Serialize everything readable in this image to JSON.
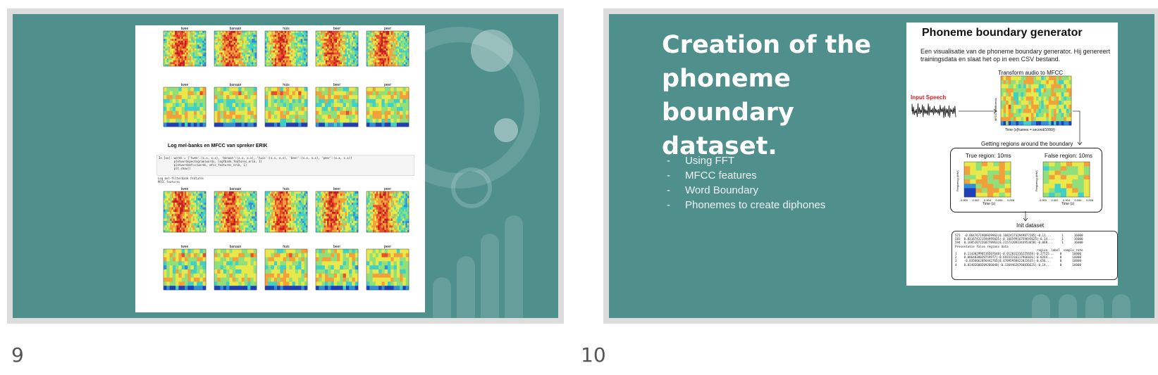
{
  "slides": [
    {
      "number": "9",
      "notebook": {
        "words": [
          "twee",
          "banaan",
          "huis",
          "beer",
          "peer"
        ],
        "section_title": "Log mel-banks en MFCC van spreker ERIK",
        "code_lines": [
          "In [xx]: words = {'twee':(x.x, x.x), 'banaan':(x.x, x.x), 'huis':(x.x, x.x), 'beer':(x.x, x.x), 'peer':(x.x, x.x)}",
          "         plotwordspectogram(words, logfbank_features_erik, 1)",
          "         plotwordsmfcc(words, mfcc_features_erik, 1)",
          "         plt.show()"
        ],
        "output_lines": [
          "Log mel-filterbank features",
          "MFCC features"
        ]
      },
      "colors": {
        "background": "#4f908d"
      }
    },
    {
      "number": "10",
      "title": "Creation of the phoneme boundary dataset.",
      "bullets": [
        "Using FFT",
        "MFCC features",
        "Word Boundary",
        "Phonemes to create diphones"
      ],
      "figure": {
        "title": "Phoneme boundary generator",
        "description": "Een visualisatie van de phoneme boundary generator. Hij genereert trainingsdata en slaat het op in een CSV bestand.",
        "transform_label": "Transform audio to MFCC",
        "input_label": "Input Speech",
        "mfcc_ylabel": "MFCC coefficients",
        "mfcc_xlabel": "Time (x(frames = second/1000))",
        "regions_label": "Getting regions around the boundary",
        "true_region_label": "True region: 10ms",
        "false_region_label": "False region: 10ms",
        "freq_label": "Frequency (kHz)",
        "time_label": "Time (s)",
        "region_ticks": [
          "0.000",
          "0.002",
          "0.004",
          "0.006",
          "0.008"
        ],
        "init_label": "Init dataset",
        "dataset_lines": [
          "573  -0.0647671908929962|0.168241732949877285|-0.11...      1      16000",
          "583  0.031674321594995035|-0.16659916759693625|-0.14...     1      16000",
          "594  0.16852072268778963|0.215732091344953658|-0.068...     1      16000",
          "Presentatie false regions data",
          "                                              region  label  sample_rate",
          "1    0.114302990516507648|-0.012831316225658|-0.27725...   0      16000",
          "2    0.0864830029759977|-0.69331316117966826|-0.0264...    0      16000",
          "3    -0.0356662056442765|0.47095958422022635|-0.656...     0      16000",
          "4    0.01402600209286040|-0.13694626760836625|-0.14...     0      16000"
        ]
      },
      "colors": {
        "background": "#4f908d",
        "input_speech": "#d42020"
      }
    }
  ]
}
